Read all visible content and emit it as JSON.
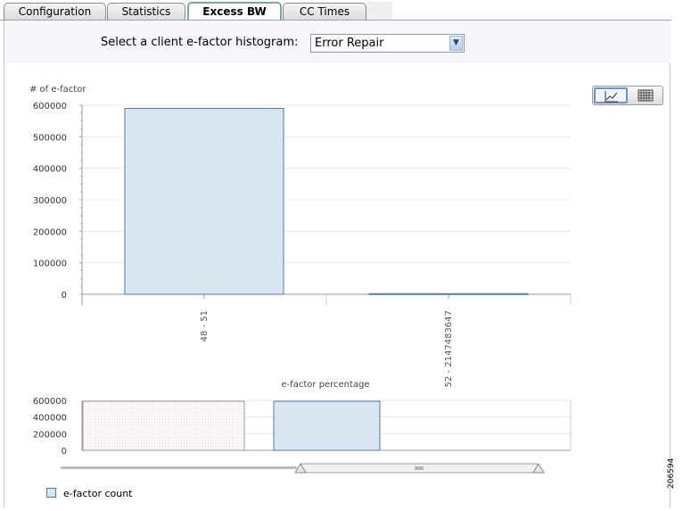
{
  "tabs": [
    {
      "label": "Configuration",
      "active": false
    },
    {
      "label": "Statistics",
      "active": false
    },
    {
      "label": "Excess BW",
      "active": true
    },
    {
      "label": "CC Times",
      "active": false
    }
  ],
  "selector": {
    "label": "Select a client e-factor histogram:",
    "value": "Error Repair"
  },
  "view_toggle": {
    "icons": [
      "line-chart-icon",
      "table-icon"
    ],
    "selected": 0
  },
  "legend": {
    "label": "e-factor count",
    "color": "#d8e6f1"
  },
  "figure_id": "206594",
  "colors": {
    "bar_fill": "#d8e6f1",
    "bar_stroke": "#4f7ca8",
    "tab_active_border": "#7aa9a3"
  },
  "chart_data": [
    {
      "type": "bar",
      "ylabel": "# of e-factor",
      "categories": [
        "48 - 51",
        "52 - 2147483647"
      ],
      "series": [
        {
          "name": "e-factor count",
          "values": [
            590000,
            2000
          ]
        }
      ],
      "ylim": [
        0,
        600000
      ],
      "yticks": [
        0,
        100000,
        200000,
        300000,
        400000,
        500000,
        600000
      ],
      "grid": true,
      "legend": "bottom-left"
    },
    {
      "type": "bar",
      "title": "e-factor percentage",
      "yticks": [
        0,
        200000,
        400000,
        600000
      ],
      "ylim": [
        0,
        600000
      ],
      "values": [
        590000,
        590000
      ],
      "grid": true
    }
  ]
}
